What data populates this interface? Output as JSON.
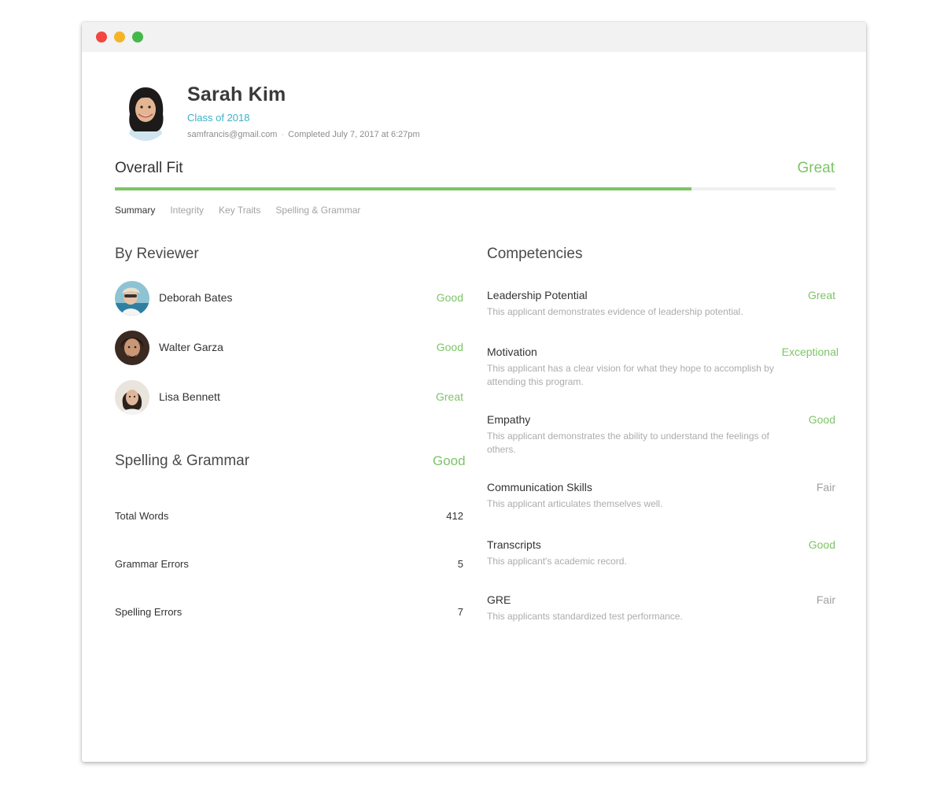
{
  "applicant": {
    "name": "Sarah Kim",
    "class_of": "Class of 2018",
    "email": "samfrancis@gmail.com",
    "separator": "·",
    "completed": "Completed July 7, 2017 at 6:27pm"
  },
  "overall_fit": {
    "label": "Overall Fit",
    "rating": "Great",
    "progress": 0.8
  },
  "tabs": [
    {
      "label": "Summary",
      "active": true
    },
    {
      "label": "Integrity",
      "active": false
    },
    {
      "label": "Key Traits",
      "active": false
    },
    {
      "label": "Spelling & Grammar",
      "active": false
    }
  ],
  "by_reviewer": {
    "title": "By Reviewer",
    "reviewers": [
      {
        "name": "Deborah Bates",
        "rating": "Good"
      },
      {
        "name": "Walter Garza",
        "rating": "Good"
      },
      {
        "name": "Lisa Bennett",
        "rating": "Great"
      }
    ]
  },
  "spelling_grammar": {
    "title": "Spelling & Grammar",
    "rating": "Good",
    "stats": [
      {
        "label": "Total Words",
        "value": "412"
      },
      {
        "label": "Grammar Errors",
        "value": "5"
      },
      {
        "label": "Spelling Errors",
        "value": "7"
      }
    ]
  },
  "competencies": {
    "title": "Competencies",
    "items": [
      {
        "name": "Leadership Potential",
        "rating": "Great",
        "description": "This applicant demonstrates evidence of leadership potential."
      },
      {
        "name": "Motivation",
        "rating": "Exceptional",
        "description": "This applicant has a clear vision for what they hope to accomplish by attending this program."
      },
      {
        "name": "Empathy",
        "rating": "Good",
        "description": "This applicant demonstrates the ability to understand the feelings of others."
      },
      {
        "name": "Communication Skills",
        "rating": "Fair",
        "description": "This applicant articulates themselves well."
      },
      {
        "name": "Transcripts",
        "rating": "Good",
        "description": "This applicant's academic record."
      },
      {
        "name": "GRE",
        "rating": "Fair",
        "description": "This applicants standardized test performance."
      }
    ]
  },
  "colors": {
    "positive": "#7dc466",
    "neutral": "#a0a0a0",
    "accent": "#3eb1c8"
  }
}
